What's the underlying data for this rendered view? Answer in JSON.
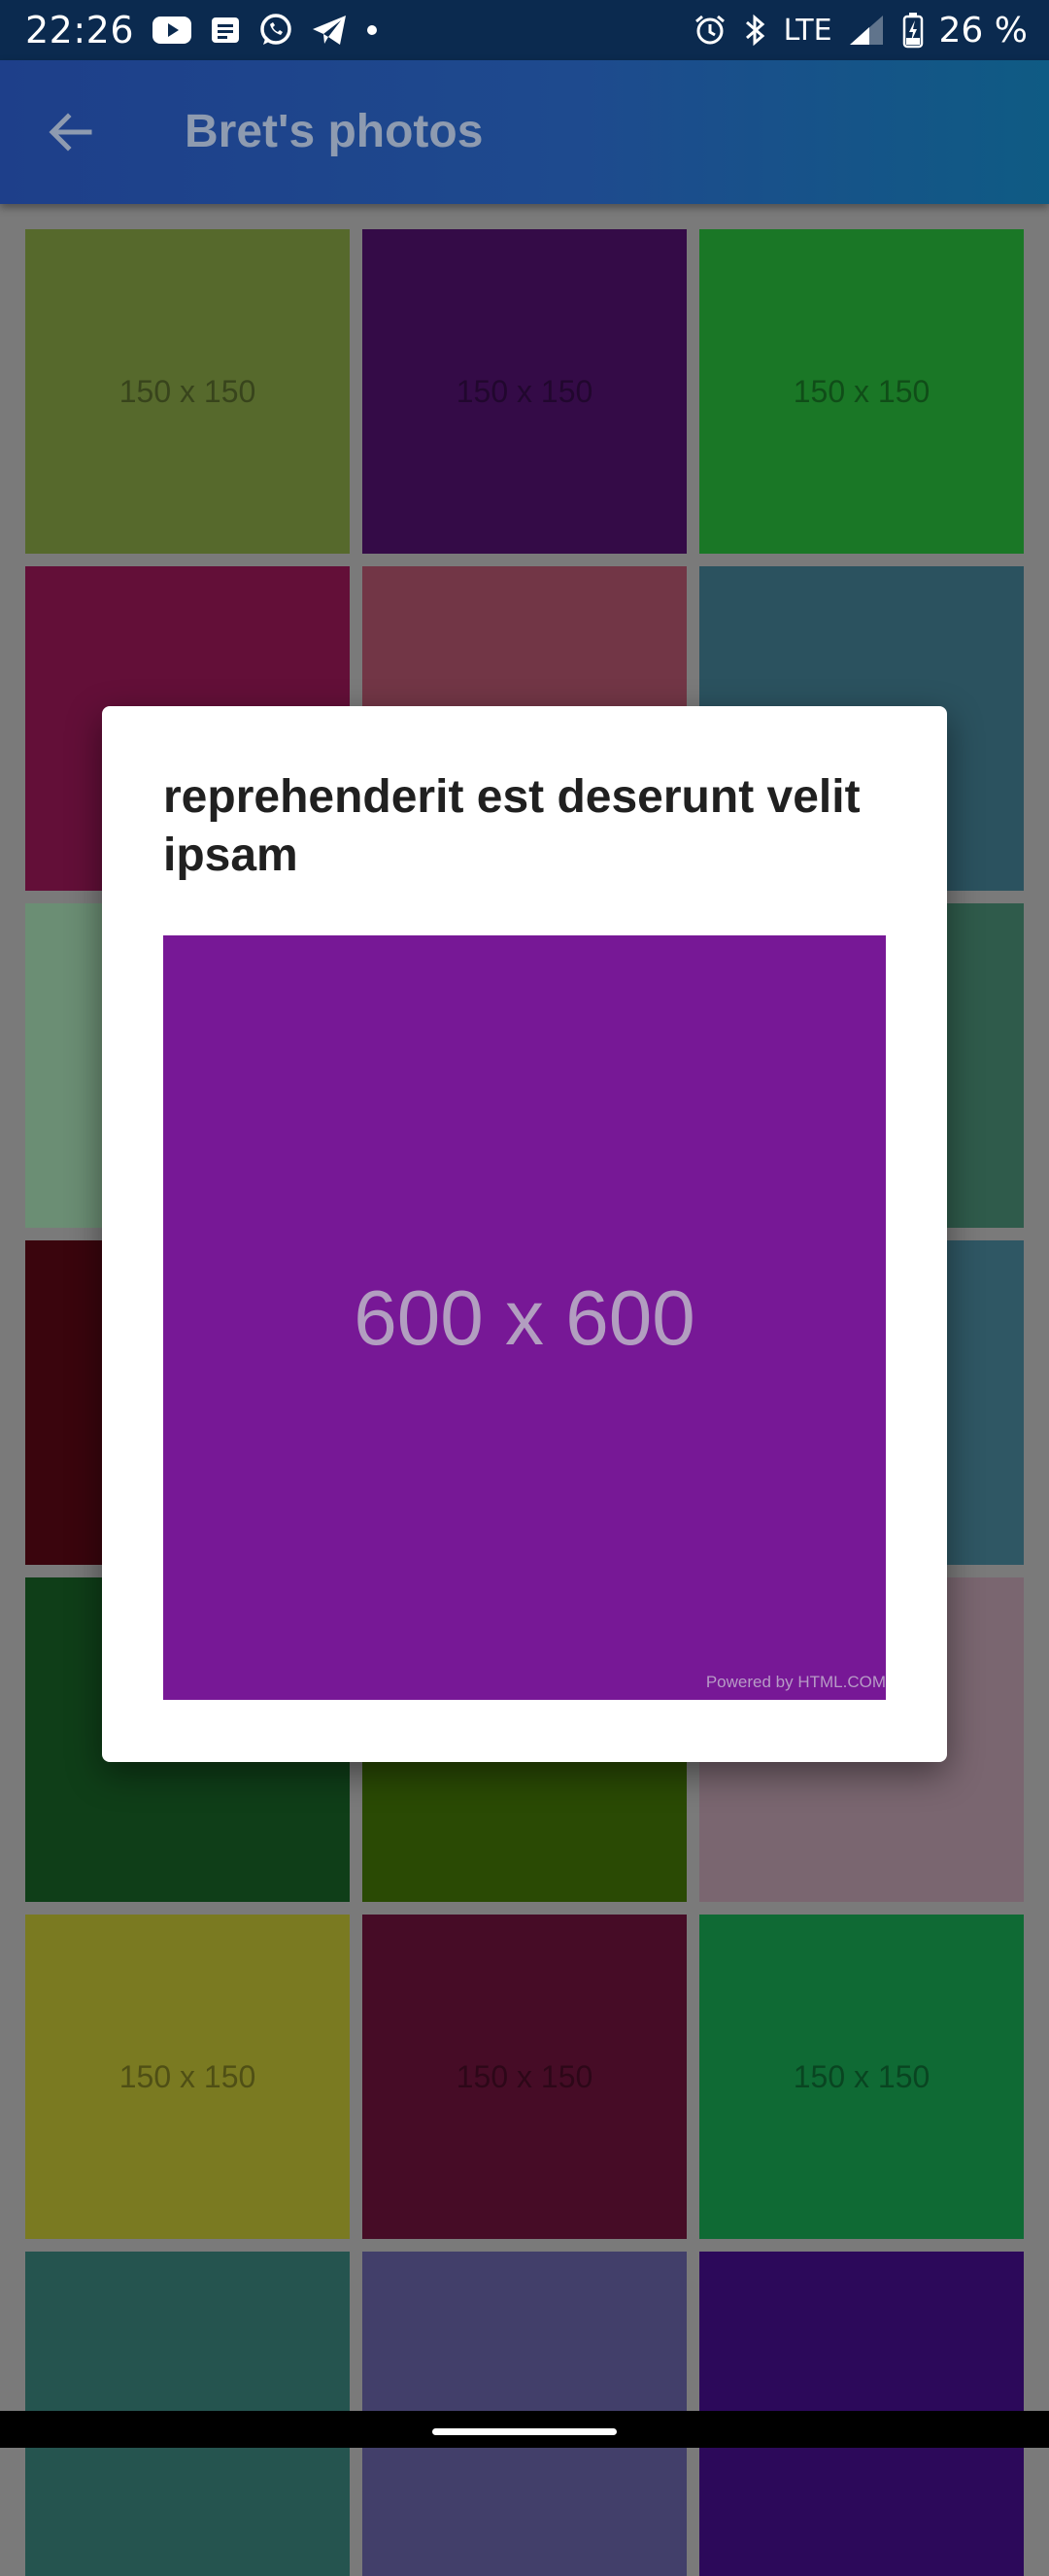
{
  "status_bar": {
    "time": "22:26",
    "network": "LTE",
    "battery": "26 %",
    "icons_left": [
      "youtube-icon",
      "news-icon",
      "whatsapp-icon",
      "telegram-icon",
      "dot-icon"
    ],
    "icons_right": [
      "alarm-icon",
      "bluetooth-icon",
      "signal-icon",
      "battery-charging-icon"
    ]
  },
  "app_bar": {
    "title": "Bret's photos",
    "back_icon": "arrow-back-icon"
  },
  "grid": {
    "tiles": [
      {
        "label": "150 x 150",
        "color": "#56692c"
      },
      {
        "label": "150 x 150",
        "color": "#340b47"
      },
      {
        "label": "150 x 150",
        "color": "#1a7726"
      },
      {
        "label": "",
        "color": "#630f38"
      },
      {
        "label": "",
        "color": "#723646"
      },
      {
        "label": "",
        "color": "#2b525f"
      },
      {
        "label": "",
        "color": "#6b8e74"
      },
      {
        "label": "",
        "color": "#4a6f5e"
      },
      {
        "label": "",
        "color": "#2f5b4b"
      },
      {
        "label": "",
        "color": "#3a050d"
      },
      {
        "label": "",
        "color": "#3e4f63"
      },
      {
        "label": "",
        "color": "#2f5764"
      },
      {
        "label": "",
        "color": "#0f3e18"
      },
      {
        "label": "",
        "color": "#2a4a04"
      },
      {
        "label": "",
        "color": "#7a6670"
      },
      {
        "label": "150 x 150",
        "color": "#7a7a21"
      },
      {
        "label": "150 x 150",
        "color": "#460c26"
      },
      {
        "label": "150 x 150",
        "color": "#0f6a34"
      },
      {
        "label": "",
        "color": "#25544f"
      },
      {
        "label": "",
        "color": "#423f6a"
      },
      {
        "label": "",
        "color": "#2c095a"
      }
    ]
  },
  "dialog": {
    "title": "reprehenderit est deserunt velit ipsam",
    "image_label": "600 x 600",
    "image_color": "#771896",
    "image_credit": "Powered by HTML.COM"
  }
}
